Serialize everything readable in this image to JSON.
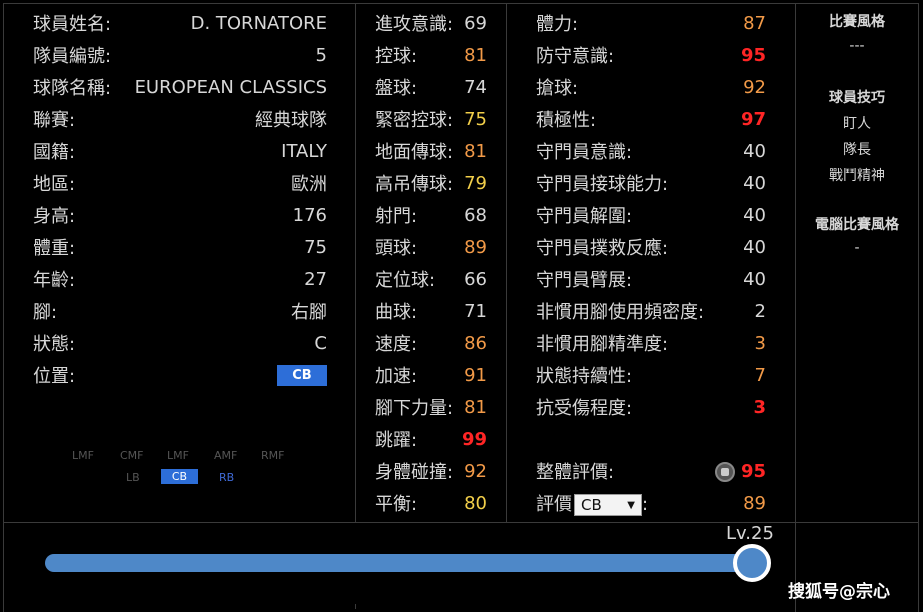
{
  "profile": [
    {
      "label": "球員姓名:",
      "value": "D. TORNATORE"
    },
    {
      "label": "隊員編號:",
      "value": "5"
    },
    {
      "label": "球隊名稱:",
      "value": "EUROPEAN CLASSICS"
    },
    {
      "label": "聯賽:",
      "value": "經典球隊"
    },
    {
      "label": "國籍:",
      "value": "ITALY"
    },
    {
      "label": "地區:",
      "value": "歐洲"
    },
    {
      "label": "身高:",
      "value": "176"
    },
    {
      "label": "體重:",
      "value": "75"
    },
    {
      "label": "年齡:",
      "value": "27"
    },
    {
      "label": "腳:",
      "value": "右腳"
    },
    {
      "label": "狀態:",
      "value": "C"
    },
    {
      "label": "位置:",
      "value": "CB"
    }
  ],
  "mini_positions": {
    "row1": [
      "LMF",
      "CMF",
      "LMF",
      "AMF",
      "RMF"
    ],
    "row2_left": "LB",
    "row2_active": "CB",
    "row2_right": "RB"
  },
  "attributes_a": [
    {
      "label": "進攻意識:",
      "value": "69",
      "color": "#d7d7d7"
    },
    {
      "label": "控球:",
      "value": "81",
      "color": "#f29a48"
    },
    {
      "label": "盤球:",
      "value": "74",
      "color": "#d7d7d7"
    },
    {
      "label": "緊密控球:",
      "value": "75",
      "color": "#f2cf4a"
    },
    {
      "label": "地面傳球:",
      "value": "81",
      "color": "#f29a48"
    },
    {
      "label": "高吊傳球:",
      "value": "79",
      "color": "#f2cf4a"
    },
    {
      "label": "射門:",
      "value": "68",
      "color": "#d7d7d7"
    },
    {
      "label": "頭球:",
      "value": "89",
      "color": "#f29a48"
    },
    {
      "label": "定位球:",
      "value": "66",
      "color": "#d7d7d7"
    },
    {
      "label": "曲球:",
      "value": "71",
      "color": "#d7d7d7"
    },
    {
      "label": "速度:",
      "value": "86",
      "color": "#f29a48"
    },
    {
      "label": "加速:",
      "value": "91",
      "color": "#f29a48"
    },
    {
      "label": "腳下力量:",
      "value": "81",
      "color": "#f29a48"
    },
    {
      "label": "跳躍:",
      "value": "99",
      "color": "#ff2525"
    },
    {
      "label": "身體碰撞:",
      "value": "92",
      "color": "#f29a48"
    },
    {
      "label": "平衡:",
      "value": "80",
      "color": "#f2cf4a"
    }
  ],
  "attributes_b": [
    {
      "label": "體力:",
      "value": "87",
      "color": "#f29a48"
    },
    {
      "label": "防守意識:",
      "value": "95",
      "color": "#ff2525"
    },
    {
      "label": "搶球:",
      "value": "92",
      "color": "#f29a48"
    },
    {
      "label": "積極性:",
      "value": "97",
      "color": "#ff2525"
    },
    {
      "label": "守門員意識:",
      "value": "40",
      "color": "#d7d7d7"
    },
    {
      "label": "守門員接球能力:",
      "value": "40",
      "color": "#d7d7d7"
    },
    {
      "label": "守門員解圍:",
      "value": "40",
      "color": "#d7d7d7"
    },
    {
      "label": "守門員撲救反應:",
      "value": "40",
      "color": "#d7d7d7"
    },
    {
      "label": "守門員臂展:",
      "value": "40",
      "color": "#d7d7d7"
    },
    {
      "label": "非慣用腳使用頻密度:",
      "value": "2",
      "color": "#d7d7d7"
    },
    {
      "label": "非慣用腳精準度:",
      "value": "3",
      "color": "#f29a48"
    },
    {
      "label": "狀態持續性:",
      "value": "7",
      "color": "#f29a48"
    },
    {
      "label": "抗受傷程度:",
      "value": "3",
      "color": "#ff2525"
    }
  ],
  "overall": {
    "label": "整體評價:",
    "value": "95",
    "color": "#ff2525"
  },
  "rating": {
    "label": "評價",
    "selected": "CB",
    "suffix": ":",
    "value": "89",
    "color": "#f29a48"
  },
  "sidebar": {
    "style_title": "比賽風格",
    "style_value": "---",
    "skills_title": "球員技巧",
    "skills": [
      "盯人",
      "隊長",
      "戰鬥精神"
    ],
    "com_title": "電腦比賽風格",
    "com_value": "-"
  },
  "level": {
    "label": "Lv.25",
    "progress": 1.0
  },
  "watermark": "搜狐号@宗心"
}
